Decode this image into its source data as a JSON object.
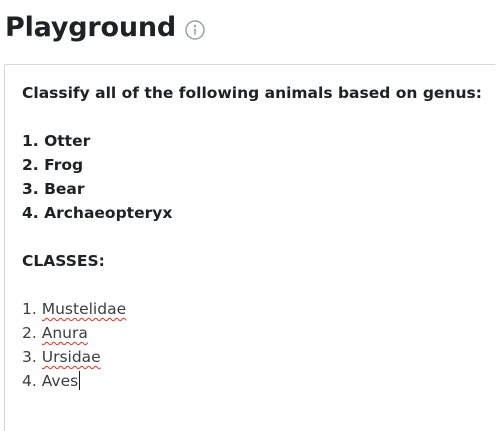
{
  "header": {
    "title": "Playground",
    "info_icon": "info-circle-icon"
  },
  "editor": {
    "prompt": {
      "instruction": "Classify all of the following animals based on genus:",
      "animals": [
        {
          "number": "1.",
          "name": "Otter"
        },
        {
          "number": "2.",
          "name": "Frog"
        },
        {
          "number": "3.",
          "name": "Bear"
        },
        {
          "number": "4.",
          "name": "Archaeopteryx"
        }
      ],
      "classes_heading": "CLASSES:"
    },
    "completion": [
      {
        "number": "1.",
        "name": "Mustelidae"
      },
      {
        "number": "2.",
        "name": "Anura"
      },
      {
        "number": "3.",
        "name": "Ursidae"
      },
      {
        "number": "4.",
        "name": "Aves"
      }
    ]
  },
  "colors": {
    "title": "#202124",
    "border": "#d5d7db",
    "info_icon": "#9aa0a6",
    "spellcheck_underline": "#d93025"
  }
}
